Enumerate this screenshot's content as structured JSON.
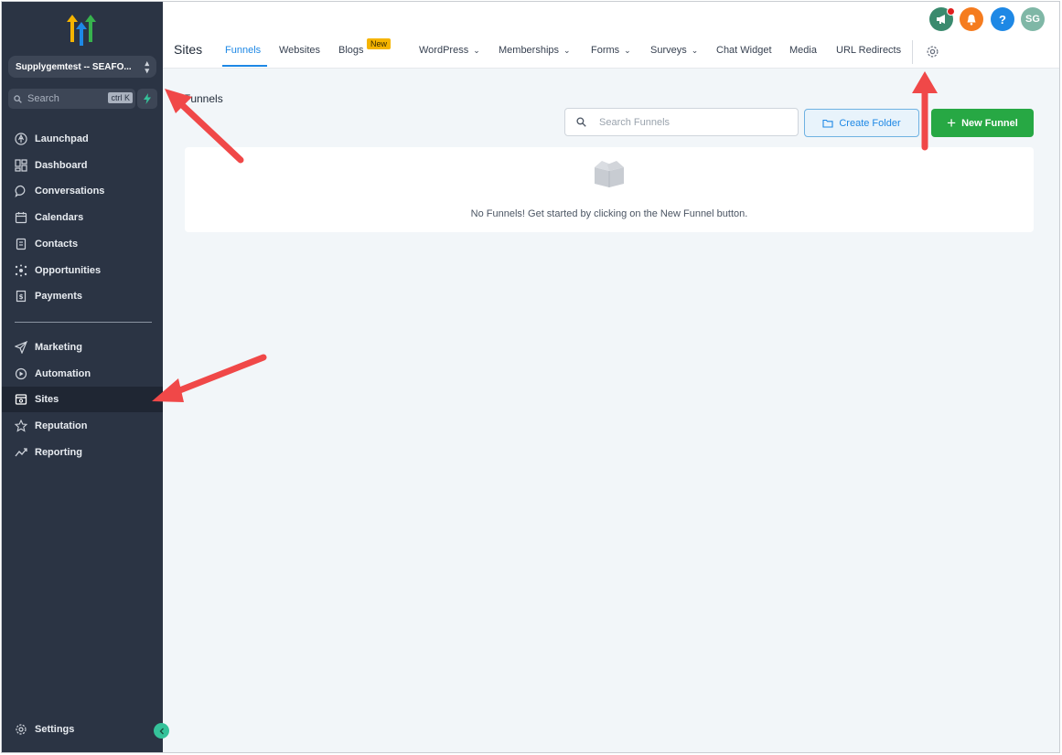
{
  "sidebar": {
    "account_name": "Supplygemtest -- SEAFO...",
    "search_placeholder": "Search",
    "search_shortcut": "ctrl K",
    "items": [
      {
        "label": "Launchpad",
        "icon": "rocket-icon"
      },
      {
        "label": "Dashboard",
        "icon": "grid-icon"
      },
      {
        "label": "Conversations",
        "icon": "chat-bubble-icon"
      },
      {
        "label": "Calendars",
        "icon": "calendar-icon"
      },
      {
        "label": "Contacts",
        "icon": "contact-book-icon"
      },
      {
        "label": "Opportunities",
        "icon": "network-icon"
      },
      {
        "label": "Payments",
        "icon": "receipt-icon"
      }
    ],
    "items2": [
      {
        "label": "Marketing",
        "icon": "send-icon"
      },
      {
        "label": "Automation",
        "icon": "play-circle-icon"
      },
      {
        "label": "Sites",
        "icon": "browser-window-icon",
        "active": true
      },
      {
        "label": "Reputation",
        "icon": "star-icon"
      },
      {
        "label": "Reporting",
        "icon": "trend-line-icon"
      }
    ],
    "settings_label": "Settings"
  },
  "header": {
    "title": "Sites",
    "tabs": [
      {
        "label": "Funnels",
        "active": true
      },
      {
        "label": "Websites"
      },
      {
        "label": "Blogs",
        "badge": "New"
      },
      {
        "label": "WordPress",
        "dropdown": true
      },
      {
        "label": "Memberships",
        "dropdown": true
      },
      {
        "label": "Forms",
        "dropdown": true
      },
      {
        "label": "Surveys",
        "dropdown": true
      },
      {
        "label": "Chat Widget"
      },
      {
        "label": "Media"
      },
      {
        "label": "URL Redirects"
      }
    ],
    "avatar_initials": "SG"
  },
  "content": {
    "section_label": "Funnels",
    "search_placeholder": "Search Funnels",
    "create_folder_label": "Create Folder",
    "new_funnel_label": "New Funnel",
    "empty_message": "No Funnels! Get started by clicking on the New Funnel button."
  },
  "colors": {
    "sidebar_bg": "#2b3444",
    "accent_blue": "#1e88e5",
    "primary_green": "#27a844",
    "annotation_red": "#f04848"
  }
}
